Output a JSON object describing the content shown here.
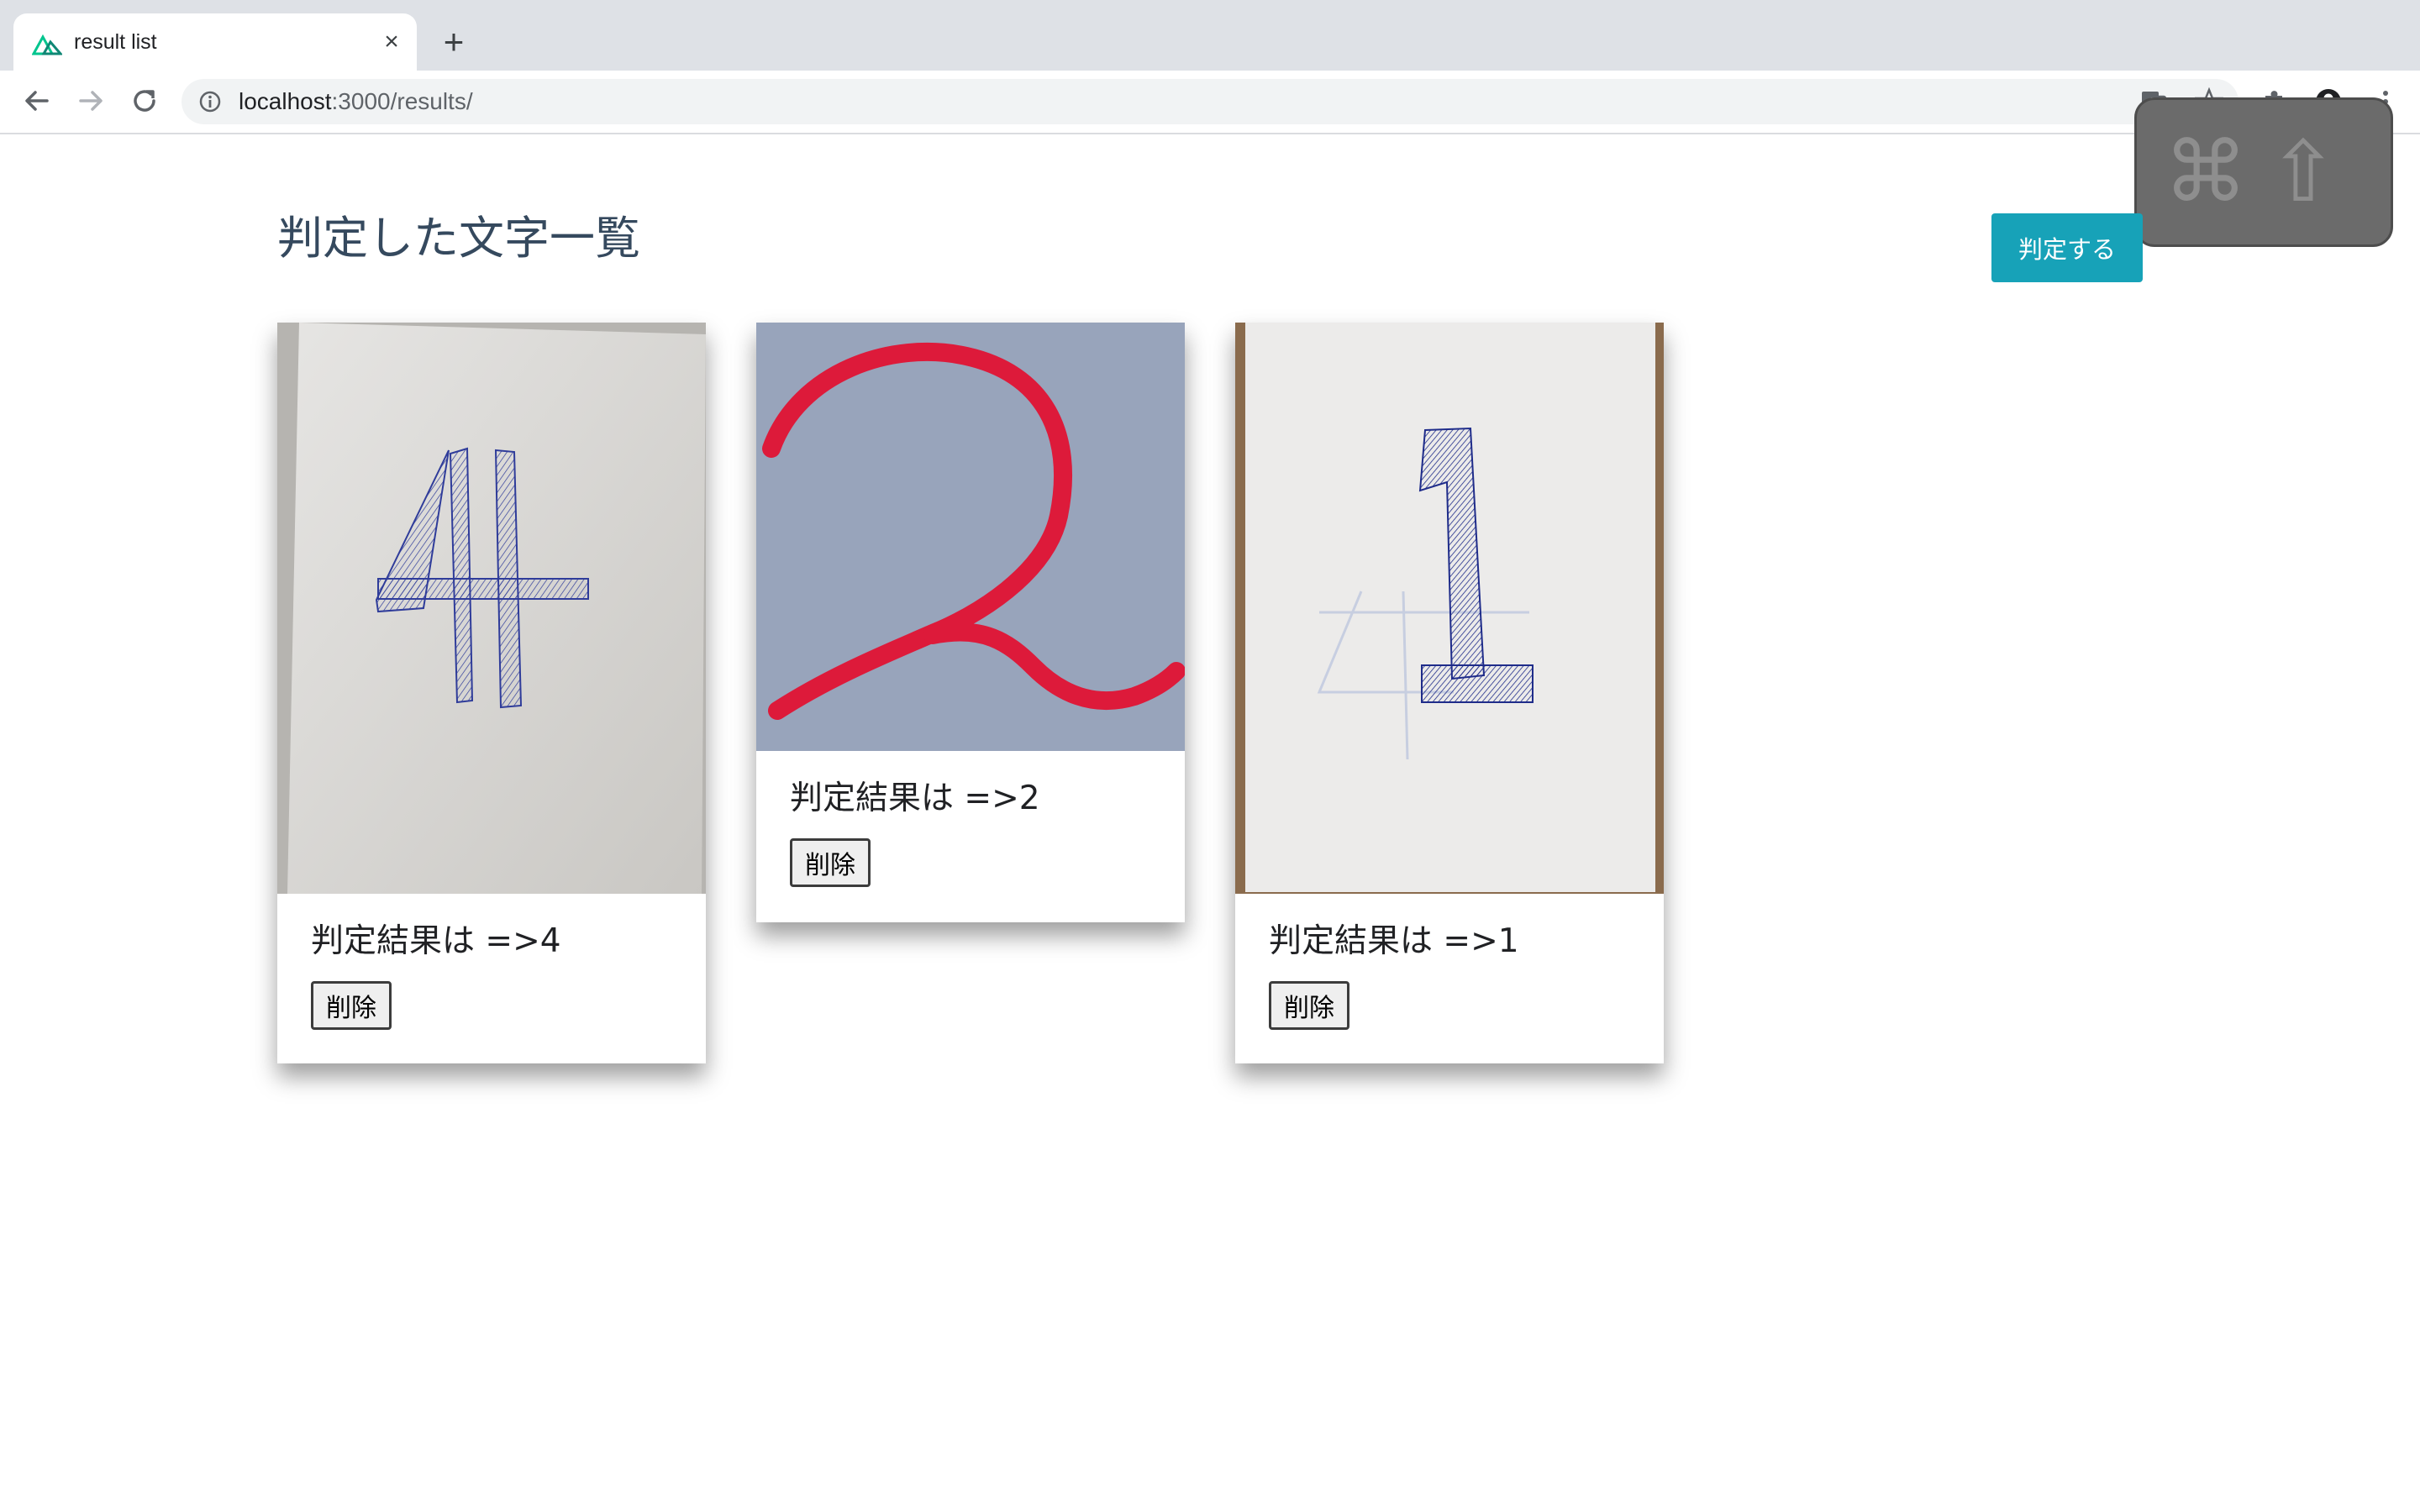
{
  "browser": {
    "tab_title": "result list",
    "tab_close": "×",
    "new_tab": "+",
    "url_host": "localhost",
    "url_rest": ":3000/results/"
  },
  "overlay": {
    "command_key": "⌘",
    "shift_key": "⇧"
  },
  "page": {
    "title": "判定した文字一覧",
    "judge_button": "判定する"
  },
  "results": [
    {
      "digit": "4",
      "result_text": "判定結果は =>4",
      "delete_label": "削除"
    },
    {
      "digit": "2",
      "result_text": "判定結果は =>2",
      "delete_label": "削除"
    },
    {
      "digit": "1",
      "result_text": "判定結果は =>1",
      "delete_label": "削除"
    }
  ],
  "colors": {
    "accent": "#17a2b8",
    "title": "#35495e",
    "ink_blue": "#2a3a9c",
    "ink_red": "#e0203c"
  }
}
